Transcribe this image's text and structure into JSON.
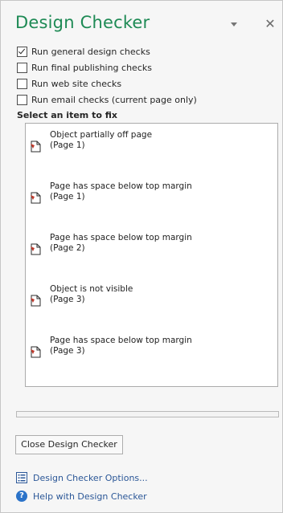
{
  "pane": {
    "title": "Design Checker",
    "close_glyph": "✕"
  },
  "checks": [
    {
      "label": "Run general design checks",
      "checked": true
    },
    {
      "label": "Run final publishing checks",
      "checked": false
    },
    {
      "label": "Run web site checks",
      "checked": false
    },
    {
      "label": "Run email checks (current page only)",
      "checked": false
    }
  ],
  "list": {
    "heading": "Select an item to fix",
    "items": [
      {
        "title": "Object partially off page",
        "page": "(Page 1)",
        "icon": "page-warning-icon"
      },
      {
        "title": "Page has space below top margin",
        "page": "(Page 1)",
        "icon": "page-warning-icon"
      },
      {
        "title": "Page has space below top margin",
        "page": "(Page 2)",
        "icon": "page-warning-icon"
      },
      {
        "title": "Object is not visible",
        "page": "(Page 3)",
        "icon": "page-warning-icon"
      },
      {
        "title": "Page has space below top margin",
        "page": "(Page 3)",
        "icon": "page-warning-icon"
      }
    ]
  },
  "buttons": {
    "close_checker": "Close Design Checker"
  },
  "links": {
    "options": "Design Checker Options...",
    "help": "Help with Design Checker",
    "help_glyph": "?"
  },
  "colors": {
    "title": "#1e8a55",
    "link": "#2b5797",
    "warning_icon": "#c0392b"
  }
}
